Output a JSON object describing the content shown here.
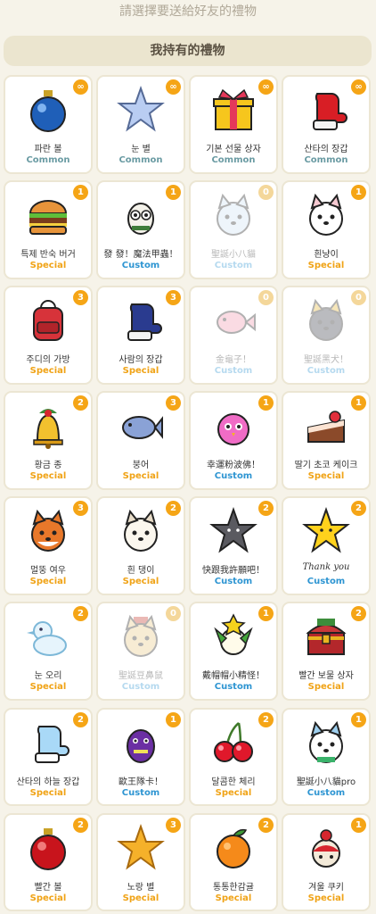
{
  "top_hint": "請選擇要送給好友的禮物",
  "section_title": "我持有的禮物",
  "gifts": [
    {
      "name": "파란 볼",
      "rarity": "Common",
      "count": "∞",
      "icon": "blue-ornament-icon"
    },
    {
      "name": "눈 별",
      "rarity": "Common",
      "count": "∞",
      "icon": "snow-star-icon"
    },
    {
      "name": "기본 선물 상자",
      "rarity": "Common",
      "count": "∞",
      "icon": "gift-box-icon"
    },
    {
      "name": "산타의 장갑",
      "rarity": "Common",
      "count": "∞",
      "icon": "red-mitten-icon"
    },
    {
      "name": "특제 반숙 버거",
      "rarity": "Special",
      "count": "1",
      "icon": "burger-icon"
    },
    {
      "name": "發 發！魔法甲蟲！",
      "rarity": "Custom",
      "count": "1",
      "icon": "owl-icon"
    },
    {
      "name": "聖誕小八貓",
      "rarity": "Custom",
      "count": "0",
      "icon": "blue-cat-icon"
    },
    {
      "name": "흰냥이",
      "rarity": "Special",
      "count": "1",
      "icon": "white-cat-icon"
    },
    {
      "name": "주디의 가방",
      "rarity": "Special",
      "count": "3",
      "icon": "backpack-icon"
    },
    {
      "name": "사람의 장갑",
      "rarity": "Special",
      "count": "3",
      "icon": "blue-mitten-icon"
    },
    {
      "name": "金龜子！",
      "rarity": "Custom",
      "count": "0",
      "icon": "pink-fish-icon"
    },
    {
      "name": "聖誕黑犬！",
      "rarity": "Custom",
      "count": "0",
      "icon": "black-dog-icon"
    },
    {
      "name": "황금 종",
      "rarity": "Special",
      "count": "2",
      "icon": "golden-bell-icon"
    },
    {
      "name": "붕어",
      "rarity": "Special",
      "count": "3",
      "icon": "fish-bun-icon"
    },
    {
      "name": "幸運粉波佛！",
      "rarity": "Custom",
      "count": "1",
      "icon": "pink-bird-icon"
    },
    {
      "name": "딸기 초코 케이크",
      "rarity": "Special",
      "count": "1",
      "icon": "cake-icon"
    },
    {
      "name": "멀뚱 여우",
      "rarity": "Special",
      "count": "3",
      "icon": "fox-icon"
    },
    {
      "name": "흰 댕이",
      "rarity": "Special",
      "count": "2",
      "icon": "white-dog-icon"
    },
    {
      "name": "快跟我許願吧！",
      "rarity": "Custom",
      "count": "2",
      "icon": "dark-star-icon"
    },
    {
      "name": "Thank you",
      "rarity": "Custom",
      "count": "2",
      "icon": "yellow-star-icon"
    },
    {
      "name": "눈 오리",
      "rarity": "Special",
      "count": "2",
      "icon": "snow-duck-icon"
    },
    {
      "name": "聖誕豆鼻鼠",
      "rarity": "Custom",
      "count": "0",
      "icon": "hat-mouse-icon"
    },
    {
      "name": "戴帽帽小精怪！",
      "rarity": "Custom",
      "count": "1",
      "icon": "green-goblin-icon"
    },
    {
      "name": "빨간 보물 상자",
      "rarity": "Special",
      "count": "2",
      "icon": "treasure-chest-icon"
    },
    {
      "name": "산타의 하늘 장갑",
      "rarity": "Special",
      "count": "2",
      "icon": "sky-mitten-icon"
    },
    {
      "name": "歐王隊卡！",
      "rarity": "Custom",
      "count": "1",
      "icon": "purple-monster-icon"
    },
    {
      "name": "달콤한 체리",
      "rarity": "Special",
      "count": "2",
      "icon": "cherry-icon"
    },
    {
      "name": "聖誕小八貓pro",
      "rarity": "Custom",
      "count": "1",
      "icon": "snow-cat-icon"
    },
    {
      "name": "빨간 볼",
      "rarity": "Special",
      "count": "2",
      "icon": "red-ornament-icon"
    },
    {
      "name": "노랑 별",
      "rarity": "Special",
      "count": "3",
      "icon": "orange-star-icon"
    },
    {
      "name": "통통한감귤",
      "rarity": "Special",
      "count": "2",
      "icon": "tangerine-icon"
    },
    {
      "name": "겨울 쿠키",
      "rarity": "Special",
      "count": "1",
      "icon": "winter-cookie-icon"
    }
  ]
}
